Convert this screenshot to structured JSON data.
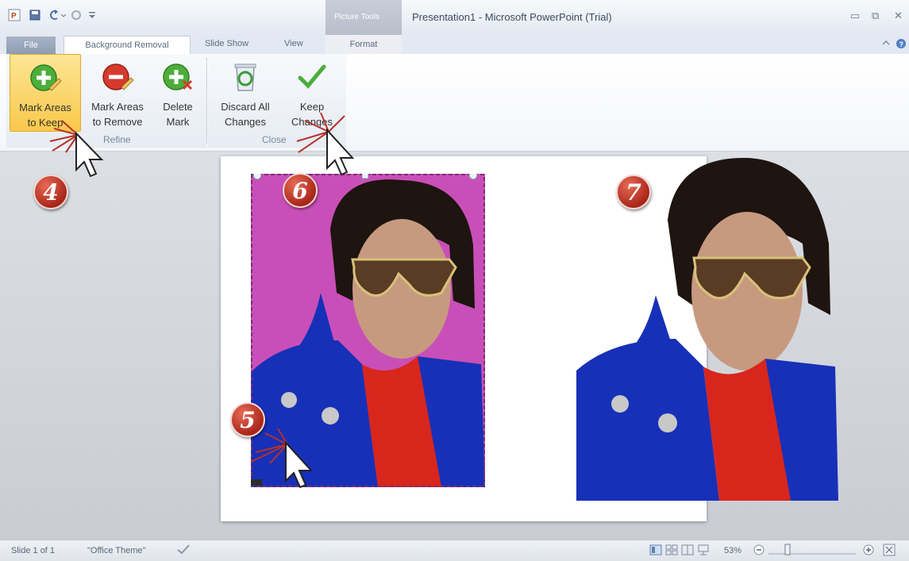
{
  "titlebar": {
    "context_header": "Picture Tools",
    "title": "Presentation1 - Microsoft PowerPoint (Trial)",
    "minimize": "▭",
    "restore": "⧉",
    "close": "✕"
  },
  "tabs": {
    "file": "File",
    "background_removal": "Background Removal",
    "slide_show": "Slide Show",
    "view": "View",
    "format": "Format"
  },
  "ribbon": {
    "mark_keep": [
      "Mark Areas",
      "to Keep"
    ],
    "mark_remove": [
      "Mark Areas",
      "to Remove"
    ],
    "delete_mark": [
      "Delete",
      "Mark"
    ],
    "discard_all": [
      "Discard All",
      "Changes"
    ],
    "keep_changes": [
      "Keep",
      "Changes"
    ],
    "group_refine": "Refine",
    "group_close": "Close"
  },
  "markers": {
    "m4": "4",
    "m5": "5",
    "m6": "6",
    "m7": "7"
  },
  "statusbar": {
    "slide": "Slide 1 of 1",
    "theme": "\"Office Theme\"",
    "zoom": "53%"
  },
  "colors": {
    "highlight": "#f9c84a",
    "selection_magenta": "#c94fb8",
    "marker_red": "#b3261a"
  }
}
